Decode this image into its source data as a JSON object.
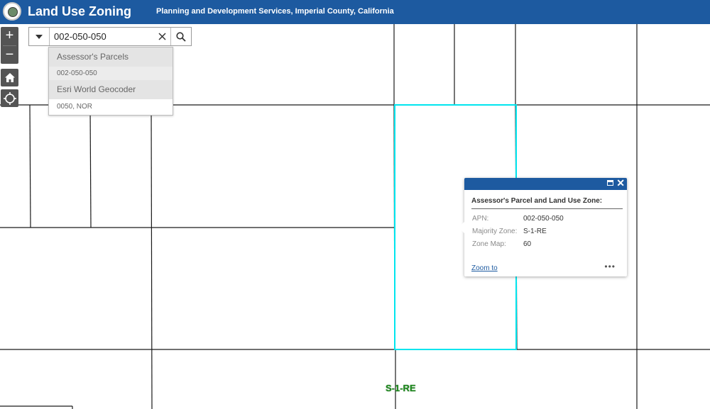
{
  "header": {
    "title": "Land Use Zoning",
    "subtitle": "Planning and Development Services, Imperial County, California"
  },
  "search": {
    "value": "002-050-050",
    "placeholder": ""
  },
  "suggestions": [
    {
      "source": "Assessor's Parcels",
      "items": [
        "002-050-050"
      ]
    },
    {
      "source": "Esri World Geocoder",
      "items": [
        "0050, NOR"
      ]
    }
  ],
  "popup": {
    "title": "Assessor's Parcel and Land Use Zone:",
    "fields": [
      {
        "label": "APN:",
        "value": "002-050-050"
      },
      {
        "label": "Majority Zone:",
        "value": "S-1-RE"
      },
      {
        "label": "Zone Map:",
        "value": "60"
      }
    ],
    "zoom_link": "Zoom to",
    "more": "•••"
  },
  "map": {
    "zone_label": "S-1-RE",
    "highlight_color": "#00e5ee",
    "parcel_line_color": "#1a1a1a"
  },
  "controls": {
    "zoom_in": "+",
    "zoom_out": "−"
  },
  "icons": {
    "logo": "county-seal-icon",
    "dropdown": "caret-down-icon",
    "clear": "close-icon",
    "search": "search-icon",
    "home": "home-icon",
    "locate": "locate-icon"
  }
}
